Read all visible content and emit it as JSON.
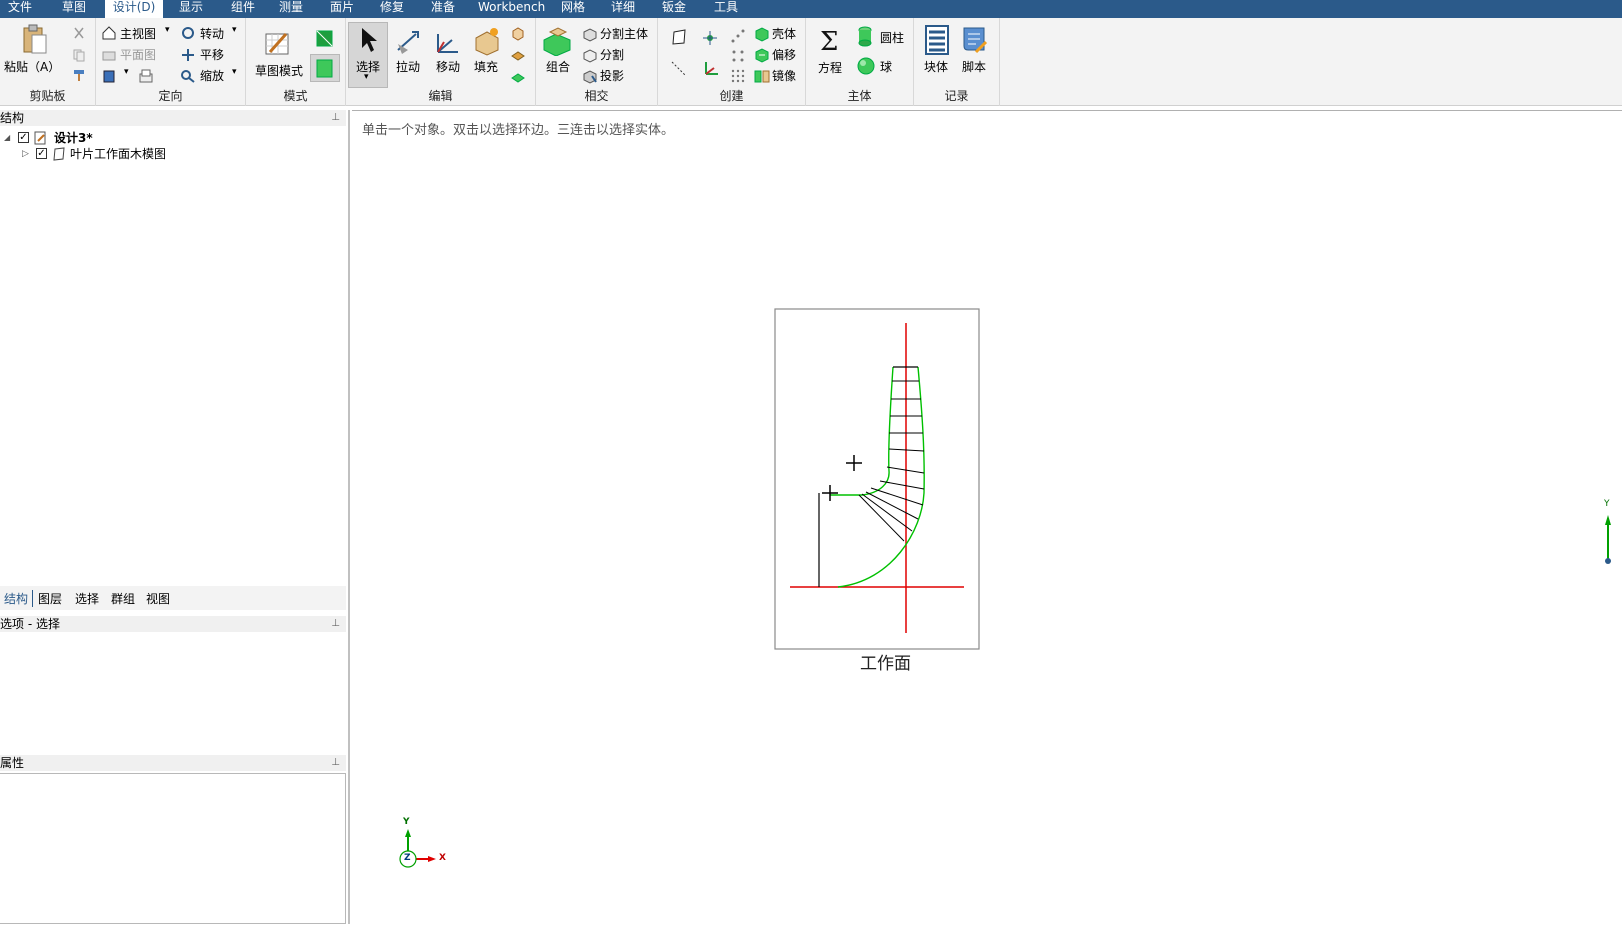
{
  "menu": {
    "tabs": [
      "文件",
      "草图",
      "设计(D)",
      "显示",
      "组件",
      "测量",
      "面片",
      "修复",
      "准备",
      "Workbench",
      "网格",
      "详细",
      "钣金",
      "工具"
    ],
    "active": "设计(D)"
  },
  "ribbon": {
    "clipboard": {
      "paste": "粘贴（A）",
      "label": "剪贴板"
    },
    "orient": {
      "home": "主视图",
      "plan": "平面图",
      "rotate": "转动",
      "pan": "平移",
      "zoom": "缩放",
      "label": "定向"
    },
    "mode": {
      "sketch": "草图模式",
      "label": "模式"
    },
    "edit": {
      "select": "选择",
      "pull": "拉动",
      "move": "移动",
      "fill": "填充",
      "label": "编辑"
    },
    "intersect": {
      "combine": "组合",
      "split_body": "分割主体",
      "split": "分割",
      "project": "投影",
      "label": "相交"
    },
    "create": {
      "shell": "壳体",
      "offset": "偏移",
      "mirror": "镜像",
      "label": "创建"
    },
    "body": {
      "equation": "方程",
      "cylinder": "圆柱",
      "sphere": "球",
      "label": "主体"
    },
    "record": {
      "block": "块体",
      "script": "脚本",
      "label": "记录"
    }
  },
  "structure": {
    "title": "结构",
    "tree": [
      {
        "label": "设计3*",
        "bold": true
      },
      {
        "label": "叶片工作面木模图",
        "bold": false
      }
    ]
  },
  "panel_tabs": [
    "结构",
    "图层",
    "选择",
    "群组",
    "视图"
  ],
  "options": {
    "title": "选项 - 选择"
  },
  "properties": {
    "title": "属性"
  },
  "viewport": {
    "hint": "单击一个对象。双击以选择环边。三连击以选择实体。",
    "plane_label": "工作面",
    "triad": {
      "x": "X",
      "y": "Y",
      "z": "Z"
    },
    "right_axis": "Y"
  },
  "colors": {
    "menubar": "#2b5a8a",
    "green_curve": "#00c000",
    "red_axis": "#e00000"
  }
}
